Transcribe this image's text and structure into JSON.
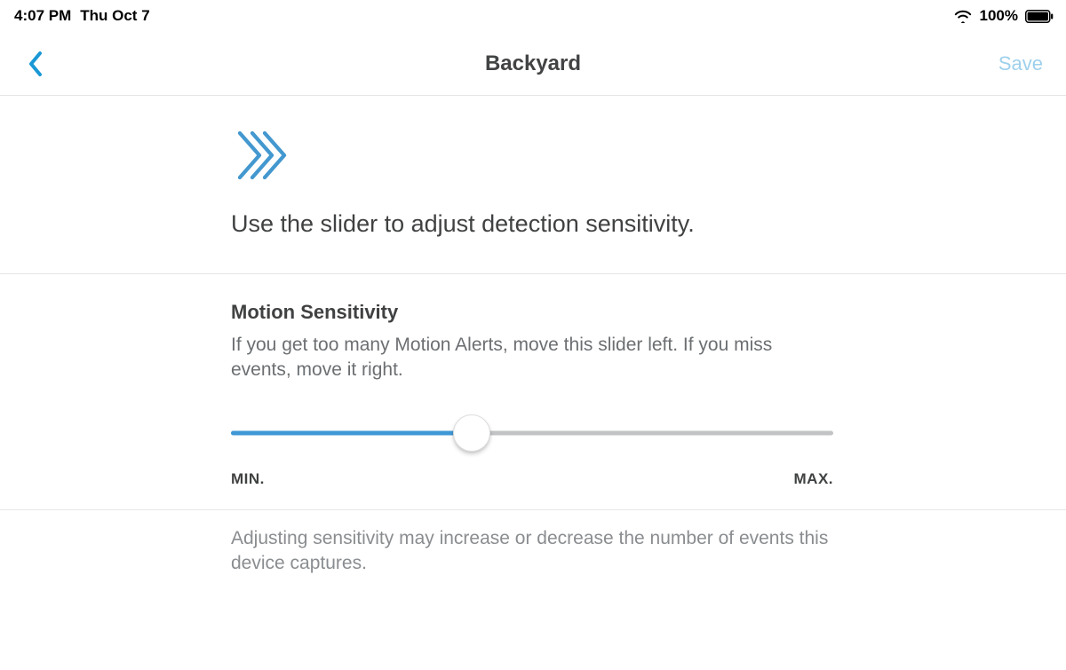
{
  "status_bar": {
    "time": "4:07 PM",
    "date": "Thu Oct 7",
    "battery_percent": "100%",
    "battery_level": 100
  },
  "header": {
    "title": "Backyard",
    "save_label": "Save"
  },
  "intro": {
    "heading": "Use the slider to adjust detection sensitivity."
  },
  "sensitivity": {
    "title": "Motion Sensitivity",
    "help": "If you get too many Motion Alerts, move this slider left. If you miss events, move it right.",
    "min_label": "MIN.",
    "max_label": "MAX.",
    "value_percent": 40
  },
  "footer": {
    "note": "Adjusting sensitivity may increase or decrease the number of events this device captures."
  },
  "colors": {
    "accent": "#3f98d5",
    "accent_light": "#9ed0ec",
    "text_primary": "#404142",
    "text_secondary": "#6c6f72",
    "text_muted": "#8a8d90",
    "divider": "#e5e5e5"
  }
}
